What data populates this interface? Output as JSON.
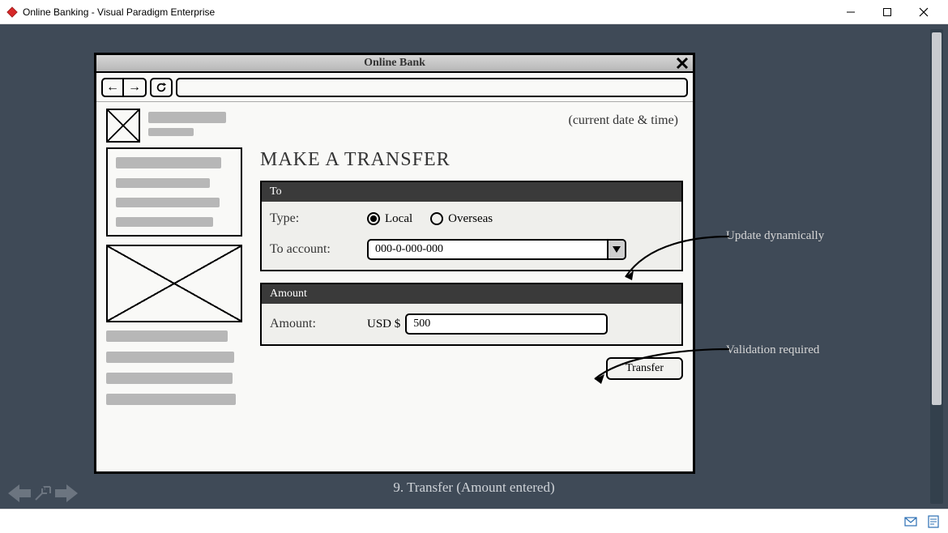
{
  "window": {
    "title": "Online Banking - Visual Paradigm Enterprise"
  },
  "wireframe": {
    "title": "Online Bank",
    "datetime_placeholder": "(current date & time)",
    "heading": "MAKE A TRANSFER",
    "to": {
      "panel_label": "To",
      "type_label": "Type:",
      "radio_local": "Local",
      "radio_overseas": "Overseas",
      "account_label": "To account:",
      "account_value": "000-0-000-000"
    },
    "amount": {
      "panel_label": "Amount",
      "field_label": "Amount:",
      "currency": "USD $",
      "value": "500"
    },
    "transfer_button": "Transfer"
  },
  "annotations": {
    "update": "Update dynamically",
    "validation": "Validation required"
  },
  "caption": "9. Transfer (Amount entered)"
}
